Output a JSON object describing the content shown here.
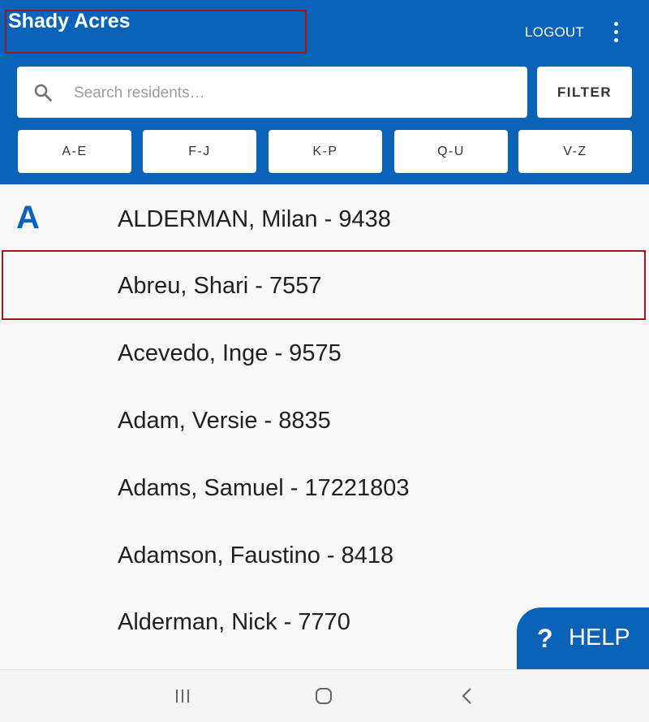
{
  "header": {
    "title": "Shady Acres",
    "logout_label": "LOGOUT",
    "menu_icon": "more-vert-icon"
  },
  "search": {
    "placeholder": "Search residents…",
    "value": "",
    "icon": "search-icon"
  },
  "filter_label": "FILTER",
  "alpha_filters": [
    "A-E",
    "F-J",
    "K-P",
    "Q-U",
    "V-Z"
  ],
  "section_letter": "A",
  "residents": [
    "ALDERMAN, Milan - 9438",
    "Abreu, Shari - 7557",
    "Acevedo, Inge - 9575",
    "Adam, Versie - 8835",
    "Adams, Samuel - 17221803",
    "Adamson, Faustino - 8418",
    "Alderman, Nick - 7770"
  ],
  "help": {
    "icon": "question-mark-icon",
    "icon_glyph": "?",
    "label": "HELP"
  },
  "navbar": {
    "recent_icon": "recent-apps-icon",
    "home_icon": "home-icon",
    "back_icon": "back-icon"
  },
  "colors": {
    "primary": "#0a63b8",
    "highlight_border": "#a3151b",
    "background": "#f8f8f8"
  }
}
